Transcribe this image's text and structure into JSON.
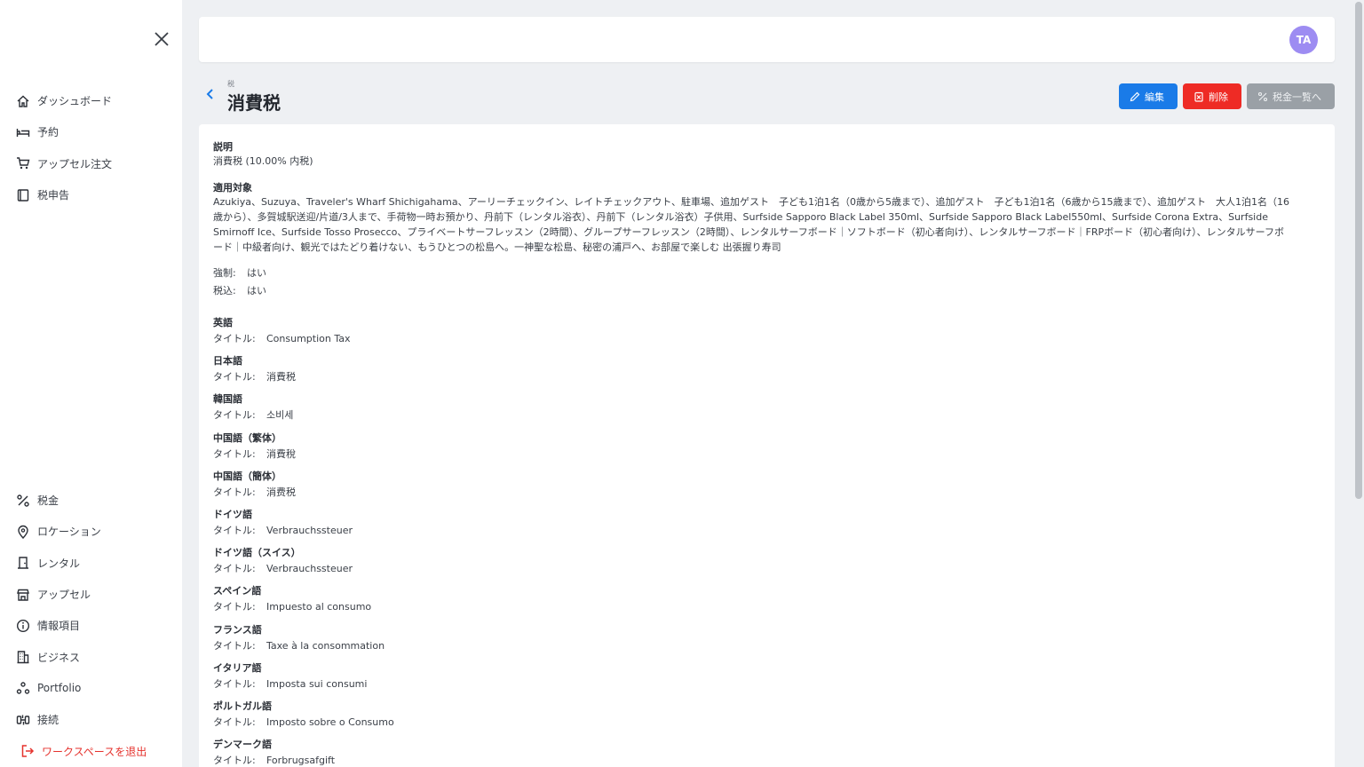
{
  "sidebar": {
    "top_items": [
      {
        "label": "ダッシュボード",
        "icon": "home-icon"
      },
      {
        "label": "予約",
        "icon": "bed-icon"
      },
      {
        "label": "アップセル注文",
        "icon": "cart-icon"
      },
      {
        "label": "税申告",
        "icon": "document-icon"
      }
    ],
    "bottom_items": [
      {
        "label": "税金",
        "icon": "percent-icon"
      },
      {
        "label": "ロケーション",
        "icon": "location-pin-icon"
      },
      {
        "label": "レンタル",
        "icon": "door-icon"
      },
      {
        "label": "アップセル",
        "icon": "store-icon"
      },
      {
        "label": "情報項目",
        "icon": "info-icon"
      },
      {
        "label": "ビジネス",
        "icon": "building-icon"
      },
      {
        "label": "Portfolio",
        "icon": "portfolio-icon"
      },
      {
        "label": "接続",
        "icon": "connection-icon"
      }
    ],
    "exit_label": "ワークスペースを退出"
  },
  "topbar": {
    "avatar_initials": "TA"
  },
  "header": {
    "breadcrumb": "税",
    "title": "消費税",
    "edit_label": "編集",
    "delete_label": "削除",
    "list_label": "税金一覧へ"
  },
  "detail": {
    "description_label": "説明",
    "description_value": "消費税 (10.00% 内税)",
    "applies_label": "適用対象",
    "applies_value": "Azukiya、Suzuya、Traveler's Wharf Shichigahama、アーリーチェックイン、レイトチェックアウト、駐車場、追加ゲスト　子ども1泊1名（0歳から5歳まで）、追加ゲスト　子ども1泊1名（6歳から15歳まで）、追加ゲスト　大人1泊1名（16歳から）、多賀城駅送迎/片道/3人まで、手荷物一時お預かり、丹前下（レンタル浴衣）、丹前下（レンタル浴衣）子供用、Surfside Sapporo Black Label 350ml、Surfside Sapporo Black Label550ml、Surfside Corona Extra、Surfside Smirnoff Ice、Surfside Tosso Prosecco、プライベートサーフレッスン（2時間）、グループサーフレッスン（2時間）、レンタルサーフボード｜ソフトボード（初心者向け）、レンタルサーフボード｜FRPボード（初心者向け）、レンタルサーフボード｜中級者向け、観光ではたどり着けない、もうひとつの松島へ。一神聖な松島、秘密の浦戸へ、お部屋で楽しむ 出張握り寿司",
    "mandatory_label": "強制:",
    "mandatory_value": "はい",
    "inclusive_label": "税込:",
    "inclusive_value": "はい",
    "title_key": "タイトル:",
    "languages": [
      {
        "name": "英語",
        "title": "Consumption Tax"
      },
      {
        "name": "日本語",
        "title": "消費税"
      },
      {
        "name": "韓国語",
        "title": "소비세"
      },
      {
        "name": "中国語（繁体）",
        "title": "消費稅"
      },
      {
        "name": "中国語（簡体）",
        "title": "消费税"
      },
      {
        "name": "ドイツ語",
        "title": "Verbrauchssteuer"
      },
      {
        "name": "ドイツ語（スイス）",
        "title": "Verbrauchssteuer"
      },
      {
        "name": "スペイン語",
        "title": "Impuesto al consumo"
      },
      {
        "name": "フランス語",
        "title": "Taxe à la consommation"
      },
      {
        "name": "イタリア語",
        "title": "Imposta sui consumi"
      },
      {
        "name": "ポルトガル語",
        "title": "Imposto sobre o Consumo"
      },
      {
        "name": "デンマーク語",
        "title": "Forbrugsafgift"
      }
    ]
  },
  "colors": {
    "accent": "#1a7be8",
    "danger": "#ee2b25",
    "avatar": "#9d8cf2"
  }
}
